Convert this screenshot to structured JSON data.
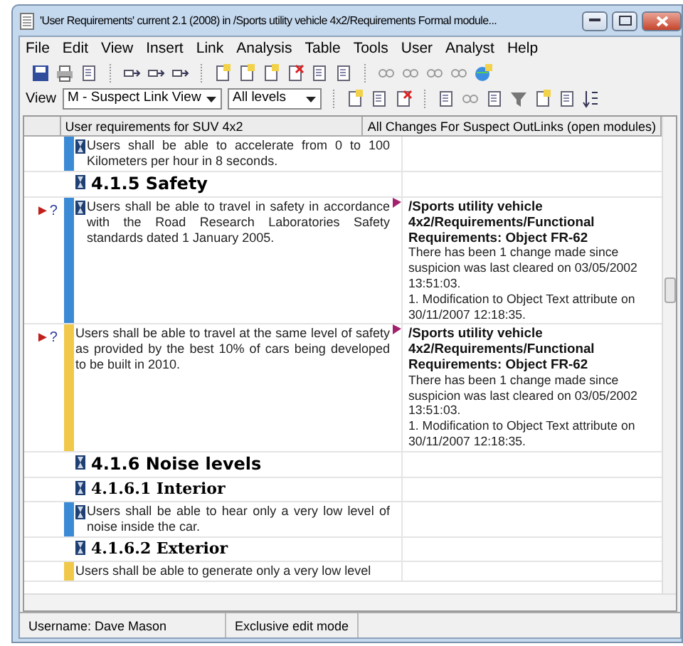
{
  "window": {
    "title": "'User Requirements' current 2.1 (2008) in /Sports utility vehicle 4x2/Requirements Formal module..."
  },
  "menu": [
    "File",
    "Edit",
    "View",
    "Insert",
    "Link",
    "Analysis",
    "Table",
    "Tools",
    "User",
    "Analyst",
    "Help"
  ],
  "view_bar": {
    "label": "View",
    "view": "M - Suspect Link View",
    "levels": "All levels"
  },
  "columns": [
    "User requirements for SUV 4x2",
    "All Changes For Suspect OutLinks (open modules)"
  ],
  "rows": [
    {
      "kind": "text",
      "color": "#3a8ad6",
      "show_icon": true,
      "flag": false,
      "text": "Users shall be able to accelerate from 0 to 100 Kilometers per hour in 8 seconds."
    },
    {
      "kind": "heading1",
      "color": null,
      "show_icon": true,
      "flag": false,
      "text": "4.1.5 Safety"
    },
    {
      "kind": "text",
      "color": "#3a8ad6",
      "show_icon": true,
      "flag": true,
      "marker": "►?",
      "text": "Users shall be able to travel in safety in accordance with the Road Research Laboratories Safety standards dated 1 January 2005.",
      "link": {
        "path": "/Sports utility vehicle 4x2/Requirements/Functional Requirements: Object FR-62",
        "details": [
          "There has been 1 change made since suspicion was last cleared on 03/05/2002 13:51:03.",
          "1. Modification to Object Text attribute on 30/11/2007 12:18:35."
        ]
      }
    },
    {
      "kind": "text",
      "color": "#f0c84a",
      "show_icon": false,
      "flag": true,
      "marker": "►?",
      "text": "Users shall be able to travel at the same level of safety as provided by the best 10% of cars being developed to be built in 2010.",
      "link": {
        "path": "/Sports utility vehicle 4x2/Requirements/Functional Requirements: Object FR-62",
        "details": [
          "There has been 1 change made since suspicion was last cleared on 03/05/2002 13:51:03.",
          "1. Modification to Object Text attribute on 30/11/2007 12:18:35."
        ]
      }
    },
    {
      "kind": "heading1",
      "color": null,
      "show_icon": true,
      "flag": false,
      "text": "4.1.6 Noise levels"
    },
    {
      "kind": "heading2",
      "color": null,
      "show_icon": true,
      "flag": false,
      "text": "4.1.6.1 Interior"
    },
    {
      "kind": "text",
      "color": "#3a8ad6",
      "show_icon": true,
      "flag": false,
      "text": "Users shall be able to hear only a very low level of noise inside the car."
    },
    {
      "kind": "heading2",
      "color": null,
      "show_icon": true,
      "flag": false,
      "text": "4.1.6.2 Exterior"
    },
    {
      "kind": "text",
      "color": "#f0c84a",
      "show_icon": false,
      "flag": false,
      "text": "Users shall be able to generate only a very low level"
    }
  ],
  "status_bar": [
    "Username: Dave Mason",
    "Exclusive edit mode"
  ]
}
